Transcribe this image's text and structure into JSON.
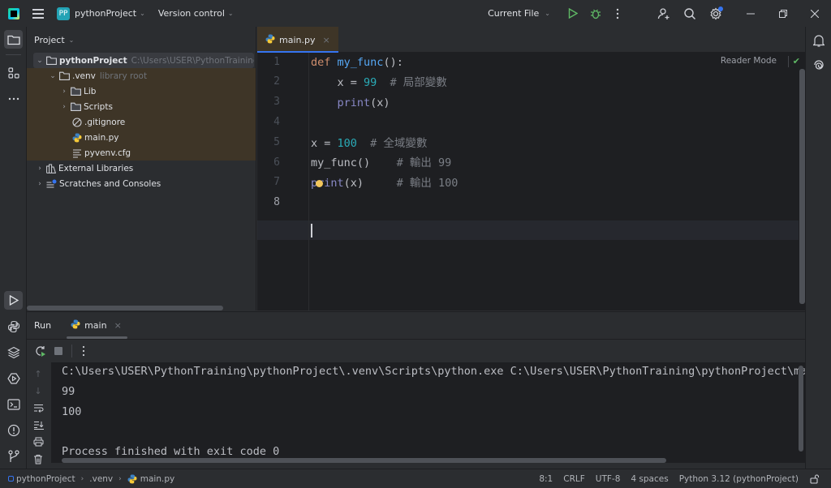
{
  "titlebar": {
    "project_badge": "PP",
    "project_name": "pythonProject",
    "version_control": "Version control",
    "run_config": "Current File"
  },
  "project_panel": {
    "title": "Project",
    "tree": [
      {
        "label": "pythonProject",
        "hint": "C:\\Users\\USER\\PythonTraining\\pythonProject",
        "icon": "folder-icon",
        "expanded": true
      },
      {
        "label": ".venv",
        "hint": "library root",
        "icon": "folder-icon",
        "expanded": true
      },
      {
        "label": "Lib",
        "icon": "folder-icon",
        "expanded": false
      },
      {
        "label": "Scripts",
        "icon": "folder-icon",
        "expanded": false
      },
      {
        "label": ".gitignore",
        "icon": "ignore-file-icon"
      },
      {
        "label": "main.py",
        "icon": "python-file-icon"
      },
      {
        "label": "pyvenv.cfg",
        "icon": "text-file-icon"
      },
      {
        "label": "External Libraries",
        "icon": "library-icon",
        "expanded": false
      },
      {
        "label": "Scratches and Consoles",
        "icon": "scratches-icon",
        "expanded": false
      }
    ]
  },
  "editor": {
    "tab_label": "main.py",
    "reader_mode": "Reader Mode",
    "line_numbers": [
      "1",
      "2",
      "3",
      "4",
      "5",
      "6",
      "7",
      "8"
    ],
    "current_line": 8,
    "code": {
      "l1_kw": "def",
      "l1_fn": "my_func",
      "l1_rest": "():",
      "l2_a": "    x = ",
      "l2_num": "99",
      "l2_cm": "  # 局部變數",
      "l3_indent": "    ",
      "l3_bi": "print",
      "l3_rest": "(x)",
      "l5_a": "x = ",
      "l5_num": "100",
      "l5_cm": "  # 全域變數",
      "l6_a": "my_func()",
      "l6_cm": "    # 輸出 99",
      "l7_bi": "print",
      "l7_rest": "(x)",
      "l7_cm": "     # 輸出 100"
    }
  },
  "run_panel": {
    "title": "Run",
    "tab_label": "main",
    "output": [
      "C:\\Users\\USER\\PythonTraining\\pythonProject\\.venv\\Scripts\\python.exe C:\\Users\\USER\\PythonTraining\\pythonProject\\main.py",
      "99",
      "100",
      "",
      "Process finished with exit code 0"
    ]
  },
  "statusbar": {
    "breadcrumbs": [
      "pythonProject",
      ".venv",
      "main.py"
    ],
    "position": "8:1",
    "line_ending": "CRLF",
    "encoding": "UTF-8",
    "indent": "4 spaces",
    "interpreter": "Python 3.12 (pythonProject)"
  },
  "colors": {
    "accent": "#3574f0",
    "run_green": "#5fb865",
    "keyword": "#cf8e6d",
    "function": "#56a8f5",
    "number": "#2aacb8",
    "comment": "#7a7e85"
  }
}
